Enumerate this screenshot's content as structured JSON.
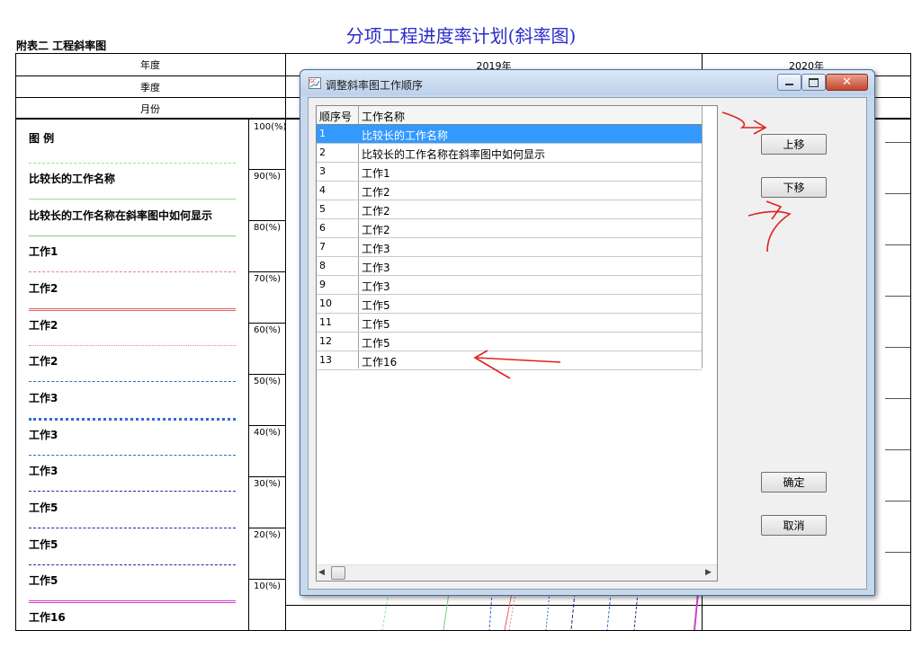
{
  "report": {
    "title": "分项工程进度率计划(斜率图)",
    "appendix": "附表二   工程斜率图",
    "header_rows": [
      "年度",
      "季度",
      "月份"
    ],
    "years": [
      "2019年",
      "2020年"
    ],
    "legend_title": "图 例",
    "legend_items": [
      "比较长的工作名称",
      "比较长的工作名称在斜率图中如何显示",
      "工作1",
      "工作2",
      "工作2",
      "工作2",
      "工作3",
      "工作3",
      "工作3",
      "工作5",
      "工作5",
      "工作5",
      "工作16"
    ],
    "percent_labels": [
      "100(%)",
      "90(%)",
      "80(%)",
      "70(%)",
      "60(%)",
      "50(%)",
      "40(%)",
      "30(%)",
      "20(%)",
      "10(%)"
    ]
  },
  "dialog": {
    "title": "调整斜率图工作顺序",
    "columns": [
      "顺序号",
      "工作名称"
    ],
    "selected_index": 0,
    "rows": [
      {
        "no": "1",
        "name": "比较长的工作名称"
      },
      {
        "no": "2",
        "name": "比较长的工作名称在斜率图中如何显示"
      },
      {
        "no": "3",
        "name": "工作1"
      },
      {
        "no": "4",
        "name": "工作2"
      },
      {
        "no": "5",
        "name": "工作2"
      },
      {
        "no": "6",
        "name": "工作2"
      },
      {
        "no": "7",
        "name": "工作3"
      },
      {
        "no": "8",
        "name": "工作3"
      },
      {
        "no": "9",
        "name": "工作3"
      },
      {
        "no": "10",
        "name": "工作5"
      },
      {
        "no": "11",
        "name": "工作5"
      },
      {
        "no": "12",
        "name": "工作5"
      },
      {
        "no": "13",
        "name": "工作16"
      }
    ],
    "buttons": {
      "move_up": "上移",
      "move_down": "下移",
      "ok": "确定",
      "cancel": "取消"
    }
  },
  "colors": {
    "title_blue": "#2c2cc8",
    "selection": "#3399ff",
    "annotation_red": "#e02020"
  }
}
